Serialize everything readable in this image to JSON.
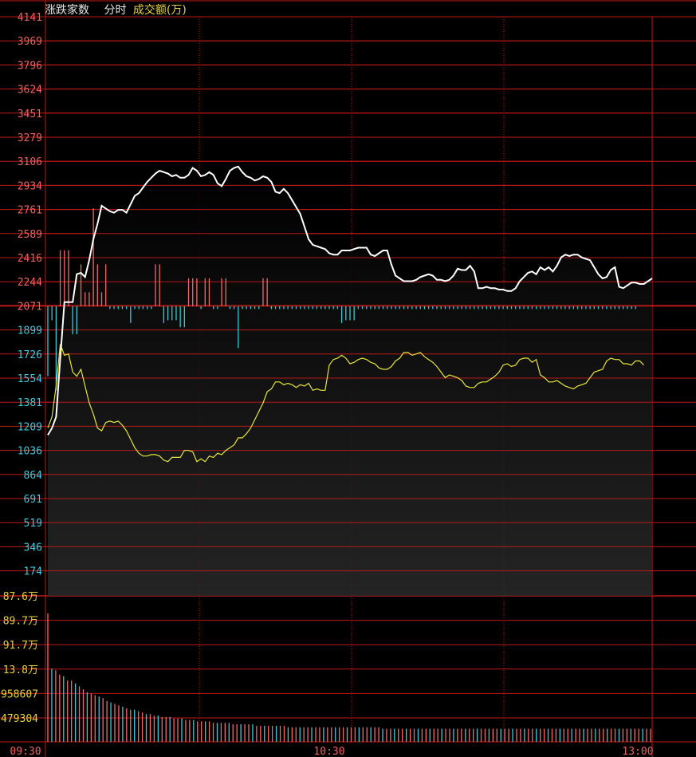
{
  "title_bar": {
    "indicator": "涨跌家数",
    "period": "分时",
    "volume_label": "成交额(万)"
  },
  "colors": {
    "grid": "#c01818",
    "up_line": "#ffffff",
    "down_line": "#e6e63c",
    "up_bar": "#f06a6a",
    "down_bar": "#3ec8d8",
    "label_up": "#f06060",
    "label_down": "#3ec8d8",
    "label_vol": "#e6d23c"
  },
  "chart_data": [
    {
      "type": "line",
      "name": "breadth",
      "y_ticks_up": [
        "4141",
        "3969",
        "3796",
        "3624",
        "3451",
        "3279",
        "3106",
        "2934",
        "2761",
        "2589",
        "2416",
        "2244",
        "2071"
      ],
      "y_ticks_down": [
        "1899",
        "1726",
        "1554",
        "1381",
        "1209",
        "1036",
        "864",
        "691",
        "519",
        "346",
        "174"
      ],
      "ylim": [
        0,
        4141
      ],
      "baseline": 2071,
      "x_labels": [
        "09:30",
        "10:30",
        "13:00"
      ],
      "series": [
        {
          "key": "up_count",
          "values": [
            1150,
            1200,
            1280,
            1700,
            2100,
            2100,
            2100,
            2300,
            2310,
            2280,
            2400,
            2550,
            2660,
            2790,
            2770,
            2750,
            2740,
            2760,
            2760,
            2740,
            2800,
            2860,
            2880,
            2920,
            2960,
            2990,
            3020,
            3040,
            3030,
            3020,
            3000,
            3010,
            2990,
            2990,
            3010,
            3060,
            3040,
            3000,
            3010,
            3030,
            3010,
            2950,
            2930,
            2980,
            3040,
            3060,
            3070,
            3030,
            3000,
            2990,
            2970,
            2980,
            3000,
            2990,
            2960,
            2890,
            2880,
            2910,
            2880,
            2830,
            2780,
            2730,
            2640,
            2550,
            2510,
            2500,
            2490,
            2480,
            2450,
            2440,
            2440,
            2470,
            2470,
            2470,
            2480,
            2490,
            2490,
            2490,
            2440,
            2430,
            2450,
            2470,
            2470,
            2370,
            2290,
            2270,
            2250,
            2250,
            2250,
            2260,
            2280,
            2290,
            2300,
            2290,
            2260,
            2260,
            2250,
            2260,
            2290,
            2340,
            2330,
            2330,
            2360,
            2320,
            2200,
            2200,
            2210,
            2200,
            2200,
            2190,
            2190,
            2180,
            2180,
            2200,
            2250,
            2280,
            2310,
            2320,
            2300,
            2350,
            2330,
            2350,
            2320,
            2360,
            2420,
            2440,
            2430,
            2440,
            2440,
            2420,
            2410,
            2400,
            2350,
            2300,
            2270,
            2280,
            2330,
            2350,
            2210,
            2200,
            2220,
            2240,
            2240,
            2230,
            2230,
            2250,
            2270
          ]
        },
        {
          "key": "down_count",
          "values": [
            1200,
            1280,
            1500,
            1800,
            1720,
            1730,
            1600,
            1570,
            1620,
            1500,
            1380,
            1300,
            1200,
            1180,
            1240,
            1250,
            1240,
            1250,
            1220,
            1180,
            1120,
            1060,
            1020,
            1000,
            1000,
            1010,
            1010,
            1000,
            970,
            960,
            990,
            990,
            990,
            1040,
            1040,
            1030,
            960,
            980,
            960,
            1000,
            990,
            1020,
            1010,
            1040,
            1060,
            1080,
            1130,
            1130,
            1160,
            1200,
            1260,
            1320,
            1380,
            1460,
            1480,
            1530,
            1530,
            1510,
            1520,
            1510,
            1490,
            1510,
            1500,
            1520,
            1470,
            1480,
            1470,
            1470,
            1650,
            1690,
            1700,
            1720,
            1700,
            1660,
            1670,
            1690,
            1700,
            1690,
            1670,
            1660,
            1630,
            1620,
            1620,
            1640,
            1680,
            1700,
            1740,
            1740,
            1720,
            1730,
            1740,
            1710,
            1690,
            1670,
            1640,
            1600,
            1560,
            1580,
            1570,
            1560,
            1540,
            1500,
            1490,
            1490,
            1520,
            1530,
            1530,
            1550,
            1570,
            1600,
            1650,
            1660,
            1640,
            1650,
            1690,
            1700,
            1700,
            1670,
            1690,
            1580,
            1560,
            1530,
            1530,
            1540,
            1520,
            1500,
            1490,
            1480,
            1500,
            1510,
            1520,
            1560,
            1600,
            1610,
            1620,
            1680,
            1700,
            1690,
            1690,
            1660,
            1660,
            1650,
            1680,
            1680,
            1650
          ]
        }
      ],
      "diff_bars": [
        -500,
        -100,
        -600,
        400,
        400,
        400,
        -200,
        -200,
        300,
        100,
        100,
        700,
        300,
        100,
        300,
        -20,
        -20,
        -20,
        -20,
        -20,
        -120,
        -20,
        -20,
        -20,
        -20,
        -20,
        300,
        300,
        -120,
        -100,
        -100,
        -100,
        -150,
        -150,
        200,
        200,
        200,
        -20,
        200,
        200,
        -20,
        -20,
        200,
        200,
        -20,
        -20,
        -300,
        -20,
        -20,
        -20,
        -20,
        -20,
        200,
        200,
        -20,
        -20,
        -20,
        -20,
        -20,
        -20,
        -20,
        -20,
        -20,
        -20,
        -20,
        -20,
        -20,
        -20,
        -20,
        -20,
        -20,
        -120,
        -100,
        -100,
        -100,
        -20,
        -20,
        -20,
        -20,
        -20,
        -20,
        -20,
        -20,
        -20,
        -20,
        -20,
        -20,
        -20,
        -20,
        -20,
        -20,
        -20,
        -20,
        -20,
        -20,
        -20,
        -20,
        -20,
        -20,
        -20,
        -20,
        -20,
        -20,
        -20,
        -20,
        -20,
        -20,
        -20,
        -20,
        -20,
        -20,
        -20,
        -20,
        -20,
        -20,
        -20,
        -20,
        -20,
        -20,
        -20,
        -20,
        -20,
        -20,
        -20,
        -20,
        -20,
        -20,
        -20,
        -20,
        -20,
        -20,
        -20,
        -20,
        -20,
        -20,
        -20,
        -20,
        -20,
        -20,
        -20,
        -20,
        -20,
        -20
      ]
    },
    {
      "type": "bar",
      "name": "turnover",
      "y_ticks": [
        "87.6万",
        "89.7万",
        "91.7万",
        "13.8万",
        "958607",
        "479304"
      ],
      "values": [
        0.88,
        0.5,
        0.49,
        0.46,
        0.45,
        0.42,
        0.42,
        0.4,
        0.38,
        0.36,
        0.34,
        0.33,
        0.32,
        0.31,
        0.3,
        0.28,
        0.27,
        0.26,
        0.25,
        0.24,
        0.23,
        0.22,
        0.22,
        0.21,
        0.2,
        0.19,
        0.19,
        0.18,
        0.18,
        0.17,
        0.17,
        0.17,
        0.16,
        0.16,
        0.16,
        0.15,
        0.15,
        0.15,
        0.14,
        0.14,
        0.14,
        0.14,
        0.13,
        0.13,
        0.13,
        0.13,
        0.13,
        0.12,
        0.12,
        0.12,
        0.12,
        0.12,
        0.12,
        0.11,
        0.11,
        0.11,
        0.11,
        0.11,
        0.11,
        0.11,
        0.11,
        0.1,
        0.1,
        0.1,
        0.1,
        0.1,
        0.1,
        0.1,
        0.1,
        0.1,
        0.1,
        0.1,
        0.1,
        0.1,
        0.1,
        0.1,
        0.1,
        0.1,
        0.1,
        0.1,
        0.1,
        0.1,
        0.1,
        0.1,
        0.1,
        0.09,
        0.09,
        0.09,
        0.09,
        0.09,
        0.09,
        0.09,
        0.09,
        0.09,
        0.09,
        0.09,
        0.09,
        0.09,
        0.09,
        0.09,
        0.09,
        0.09,
        0.09,
        0.09,
        0.09,
        0.09,
        0.09,
        0.09,
        0.09,
        0.09,
        0.09,
        0.09,
        0.09,
        0.09,
        0.09,
        0.09,
        0.09,
        0.09,
        0.09,
        0.09,
        0.09,
        0.09,
        0.09,
        0.09,
        0.09,
        0.09,
        0.09,
        0.09,
        0.09,
        0.09,
        0.09,
        0.09,
        0.09,
        0.09,
        0.09,
        0.09,
        0.09,
        0.09,
        0.09,
        0.09,
        0.09,
        0.09,
        0.09,
        0.09,
        0.09,
        0.09,
        0.09,
        0.09,
        0.09,
        0.09,
        0.09,
        0.09,
        0.09,
        0.09
      ]
    }
  ]
}
